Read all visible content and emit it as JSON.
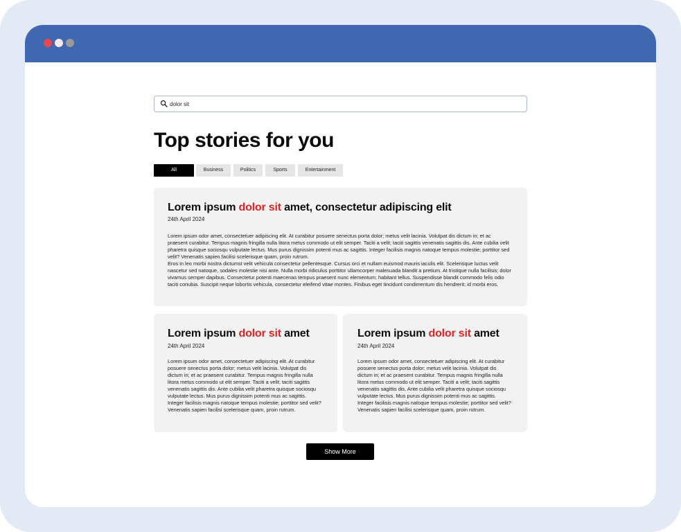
{
  "window": {
    "dot_colors": [
      "#e5484d",
      "#f2d4d4",
      "#9a9a9a"
    ],
    "titlebar_color": "#4167b0"
  },
  "search": {
    "value": "dolor sit",
    "icon": "search-icon"
  },
  "page_title": "Top stories for you",
  "tabs": [
    {
      "label": "All",
      "active": true
    },
    {
      "label": "Business",
      "active": false
    },
    {
      "label": "Politics",
      "active": false
    },
    {
      "label": "Sports",
      "active": false
    },
    {
      "label": "Entertainment",
      "active": false
    }
  ],
  "highlight_color": "#e02424",
  "featured": {
    "title_before": "Lorem ipsum ",
    "title_highlight": "dolor sit",
    "title_after": " amet, consectetur adipiscing elit",
    "date": "24th April 2024",
    "body_p1": "Lorem ipsum odor amet, consectetuer adipiscing elit. At curabitur posuere senectus porta dolor; metus velit lacinia. Volutpat dis dictum in; et ac praesent curabitur. Tempus magnis fringilla nulla litora metus commodo ut elit semper. Taciti a velit; taciti sagittis venenatis sagittis dis. Ante cubilia velit pharetra quisque sociosqu vulputate lectus. Mus purus dignissim potenti mus ac sagittis. Integer facilisis magnis natoque tempus molestie; porttitor sed velit? Venenatis sapien facilisi scelerisque quam, proin rutrum.",
    "body_p2": "Eros in leo morbi nostra dictumst velit vehicula consectetur pellentesque. Cursus orci et nullam euismod mauris iaculis elit. Scelerisque luctus velit nascetur sed natoque, sodales molestie nisi ante. Nulla morbi ridiculus porttitor ullamcorper malesuada blandit a pretium. At tristique nulla facilisis; dolor vivamus semper dapibus. Consectetur potenti maecenas tempus praesent nunc elementum; habitant tellus. Suspendisse blandit commodo felis odio taciti conubia. Suscipit neque lobortis vehicula, consectetur eleifend vitae montes. Finibus eget tincidunt condimentum dis hendrerit; id morbi eros."
  },
  "stories": [
    {
      "title_before": "Lorem ipsum ",
      "title_highlight": "dolor sit",
      "title_after": " amet",
      "date": "24th April 2024",
      "body": "Lorem ipsum odor amet, consectetuer adipiscing elit. At curabitur posuere senectus porta dolor; metus velit lacinia. Volutpat dis dictum in; et ac praesent curabitur. Tempus magnis fringilla nulla litora metus commodo ut elit semper. Taciti a velit; taciti sagittis venenatis sagittis dis. Ante cubilia velit pharetra quisque sociosqu vulputate lectus. Mus purus dignissim potenti mus ac sagittis. Integer facilisis magnis natoque tempus molestie; porttitor sed velit? Venenatis sapien facilisi scelerisque quam, proin rutrum."
    },
    {
      "title_before": "Lorem ipsum ",
      "title_highlight": "dolor sit",
      "title_after": " amet",
      "date": "24th April 2024",
      "body": "Lorem ipsum odor amet, consectetuer adipiscing elit. At curabitur posuere senectus porta dolor; metus velit lacinia. Volutpat dis dictum in; et ac praesent curabitur. Tempus magnis fringilla nulla litora metus commodo ut elit semper. Taciti a velit; taciti sagittis venenatis sagittis dis. Ante cubilia velit pharetra quisque sociosqu vulputate lectus. Mus purus dignissim potenti mus ac sagittis. Integer facilisis magnis natoque tempus molestie; porttitor sed velit? Venenatis sapien facilisi scelerisque quam, proin rutrum."
    }
  ],
  "show_more_label": "Show More"
}
